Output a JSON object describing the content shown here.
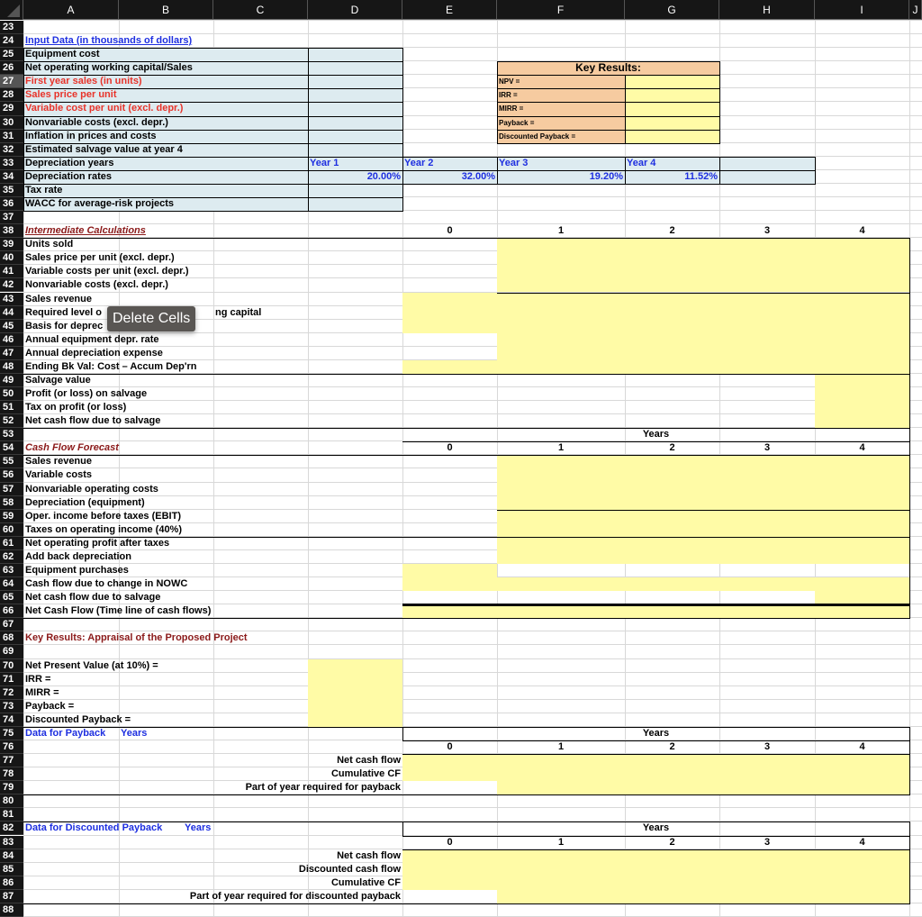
{
  "columns": [
    "A",
    "B",
    "C",
    "D",
    "E",
    "F",
    "G",
    "H",
    "I",
    "J"
  ],
  "rows": [
    "23",
    "24",
    "25",
    "26",
    "27",
    "28",
    "29",
    "30",
    "31",
    "32",
    "33",
    "34",
    "35",
    "36",
    "37",
    "38",
    "39",
    "40",
    "41",
    "42",
    "43",
    "44",
    "45",
    "46",
    "47",
    "48",
    "49",
    "50",
    "51",
    "52",
    "53",
    "54",
    "55",
    "56",
    "57",
    "58",
    "59",
    "60",
    "61",
    "62",
    "63",
    "64",
    "65",
    "66",
    "67",
    "68",
    "69",
    "70",
    "71",
    "72",
    "73",
    "74",
    "75",
    "76",
    "77",
    "78",
    "79",
    "80",
    "81",
    "82",
    "83",
    "84",
    "85",
    "86",
    "87",
    "88"
  ],
  "colors": {
    "input_fill": "#ddebf0",
    "output_fill": "#fffba6",
    "key_results_fill": "#f6cba0",
    "blue_text": "#1e2fe0",
    "red_text": "#e8332a",
    "maroon_text": "#8b1a1a",
    "header_bg": "#161616"
  },
  "input_section": {
    "title": "Input Data (in thousands of dollars)",
    "labels": [
      {
        "text": "Equipment  cost",
        "color": "black"
      },
      {
        "text": "Net operating working capital/Sales",
        "color": "black"
      },
      {
        "text": "First year sales (in units)",
        "color": "red"
      },
      {
        "text": "Sales price per unit",
        "color": "red"
      },
      {
        "text": "Variable cost per unit (excl. depr.)",
        "color": "red"
      },
      {
        "text": "Nonvariable costs (excl. depr.)",
        "color": "black"
      },
      {
        "text": "Inflation in prices and costs",
        "color": "black"
      },
      {
        "text": "Estimated salvage value at year 4",
        "color": "black"
      },
      {
        "text": "Depreciation years",
        "color": "black"
      },
      {
        "text": "Depreciation rates",
        "color": "black"
      },
      {
        "text": "Tax rate",
        "color": "black"
      },
      {
        "text": "WACC for average-risk projects",
        "color": "black"
      }
    ],
    "depreciation_years": [
      "Year 1",
      "Year 2",
      "Year 3",
      "Year 4"
    ],
    "depreciation_rates": [
      "20.00%",
      "32.00%",
      "19.20%",
      "11.52%"
    ]
  },
  "key_results_box": {
    "title": "Key Results:",
    "labels": [
      "NPV  =",
      "IRR    =",
      "MIRR =",
      "Payback =",
      "Discounted Payback ="
    ]
  },
  "intermediate": {
    "title": "Intermediate Calculations",
    "years": [
      "0",
      "1",
      "2",
      "3",
      "4"
    ],
    "labels": [
      "Units sold",
      "Sales price per unit (excl. depr.)",
      "Variable costs per unit (excl. depr.)",
      "Nonvariable costs (excl. depr.)",
      "Sales revenue",
      "Required level of net operating working capital",
      "Basis for depreciation",
      "Annual equipment depr. rate",
      "Annual depreciation expense",
      "Ending Bk Val: Cost – Accum Dep'rn",
      "Salvage value",
      "Profit (or loss) on salvage",
      "Tax on profit (or loss)",
      "Net cash flow due to salvage"
    ],
    "label_44_visible_right": "ng capital",
    "label_44_visible_left": "Required level o",
    "label_45_visible": "Basis for deprec"
  },
  "cash_flow": {
    "title": "Cash Flow Forecast",
    "years_label": "Years",
    "years": [
      "0",
      "1",
      "2",
      "3",
      "4"
    ],
    "labels": [
      "Sales revenue",
      "Variable costs",
      "Nonvariable operating costs",
      "Depreciation (equipment)",
      "Oper. income before taxes (EBIT)",
      "Taxes on operating income (40%)",
      "Net operating profit after taxes",
      "Add back depreciation",
      "Equipment purchases",
      "Cash flow due to change in NOWC",
      "Net cash flow due to salvage",
      "Net Cash Flow (Time line of cash flows)"
    ]
  },
  "appraisal": {
    "title": "Key Results:  Appraisal of the Proposed Project",
    "labels": [
      "Net Present Value (at 10%) =",
      "IRR =",
      "MIRR =",
      "Payback =",
      "Discounted Payback ="
    ]
  },
  "payback": {
    "title": "Data for Payback",
    "title_years": "Years",
    "years_label": "Years",
    "years": [
      "0",
      "1",
      "2",
      "3",
      "4"
    ],
    "labels": [
      "Net cash flow",
      "Cumulative CF",
      "Part of year required  for payback"
    ]
  },
  "discounted_payback": {
    "title": "Data for Discounted Payback",
    "title_years": "Years",
    "years_label": "Years",
    "years": [
      "0",
      "1",
      "2",
      "3",
      "4"
    ],
    "labels": [
      "Net cash flow",
      "Discounted cash flow",
      "Cumulative CF",
      "Part of year required for discounted payback"
    ]
  },
  "context_tooltip": "Delete Cells"
}
